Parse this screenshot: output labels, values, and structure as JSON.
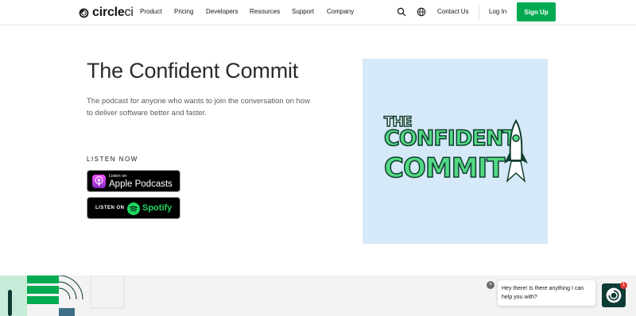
{
  "brand": {
    "name_bold": "circle",
    "name_light": "ci"
  },
  "nav": {
    "items": [
      "Product",
      "Pricing",
      "Developers",
      "Resources",
      "Support",
      "Company"
    ],
    "contact": "Contact Us",
    "login": "Log In",
    "signup": "Sign Up"
  },
  "hero": {
    "title": "The Confident Commit",
    "description": "The podcast for anyone who wants to join the conversation on how to deliver software better and faster.",
    "listen_heading": "LISTEN NOW",
    "apple": {
      "small": "Listen on",
      "big": "Apple Podcasts"
    },
    "spotify": {
      "prefix": "LISTEN ON",
      "name": "Spotify"
    }
  },
  "cover": {
    "line1": "THE",
    "line2": "CONFIDENT",
    "line3": "COMMIT"
  },
  "chat": {
    "message": "Hey there! Is there anything I can help you with?",
    "unread": "1",
    "close": "×"
  },
  "colors": {
    "accent": "#04aa51",
    "cover_bg": "#d6e9f8",
    "cover_green": "#52d883",
    "dark_teal": "#0e3b36"
  },
  "icons": [
    "circleci-logo-icon",
    "search-icon",
    "globe-icon",
    "podcast-icon",
    "spotify-icon",
    "chat-icon",
    "close-icon"
  ]
}
